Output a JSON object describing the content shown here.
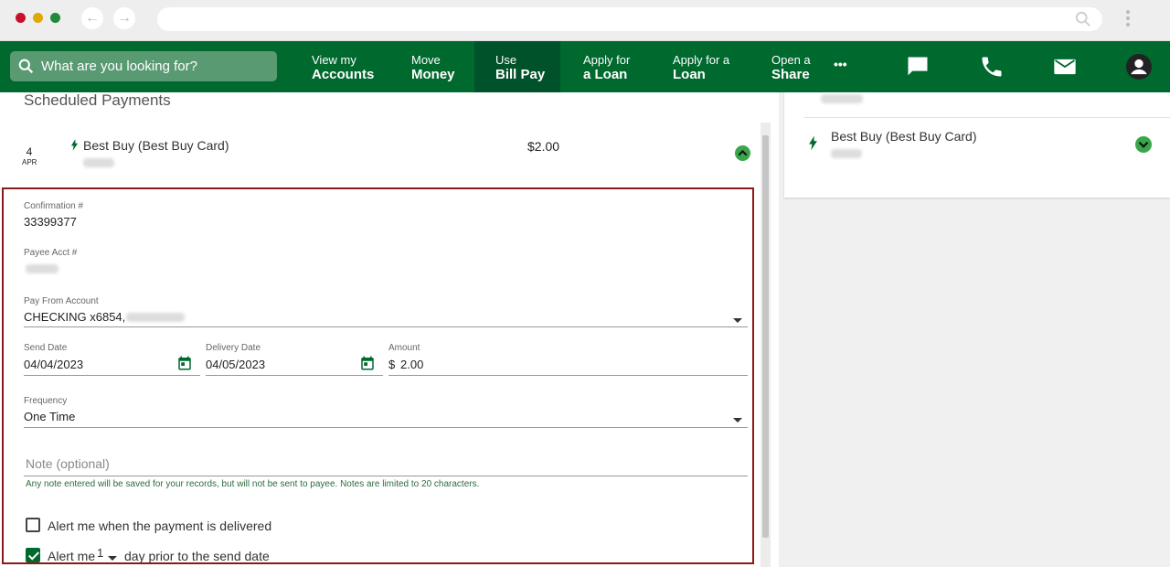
{
  "search": {
    "placeholder": "What are you looking for?"
  },
  "nav": {
    "items": [
      {
        "l1": "View my",
        "l2": "Accounts"
      },
      {
        "l1": "Move",
        "l2": "Money"
      },
      {
        "l1": "Use",
        "l2": "Bill Pay"
      },
      {
        "l1": "Apply for",
        "l2": "a Loan"
      },
      {
        "l1": "Apply for a",
        "l2": "Loan"
      },
      {
        "l1": "Open a",
        "l2": "Share"
      }
    ],
    "more": "•••"
  },
  "scheduled": {
    "title": "Scheduled Payments",
    "payment": {
      "day": "4",
      "month": "APR",
      "payee": "Best Buy (Best Buy Card)",
      "amount": "$2.00"
    }
  },
  "detail": {
    "confirmation_label": "Confirmation #",
    "confirmation_value": "33399377",
    "payee_acct_label": "Payee Acct #",
    "pay_from_label": "Pay From Account",
    "pay_from_value": "CHECKING x6854,",
    "send_date_label": "Send Date",
    "send_date_value": "04/04/2023",
    "delivery_date_label": "Delivery Date",
    "delivery_date_value": "04/05/2023",
    "amount_label": "Amount",
    "amount_prefix": "$",
    "amount_value": "2.00",
    "frequency_label": "Frequency",
    "frequency_value": "One Time",
    "note_placeholder": "Note (optional)",
    "note_hint": "Any note entered will be saved for your records, but will not be sent to payee. Notes are limited to 20 characters.",
    "alert_delivered_label": "Alert me when the payment is delivered",
    "alert_prior_prefix": "Alert me",
    "alert_prior_days": "1",
    "alert_prior_suffix": "day prior to the send date"
  },
  "right": {
    "payee": "Best Buy (Best Buy Card)"
  },
  "colors": {
    "brand_green": "#00692e",
    "active_nav": "#00522a",
    "highlight_border": "#8b1a1a",
    "accent_green": "#3aa64a"
  }
}
